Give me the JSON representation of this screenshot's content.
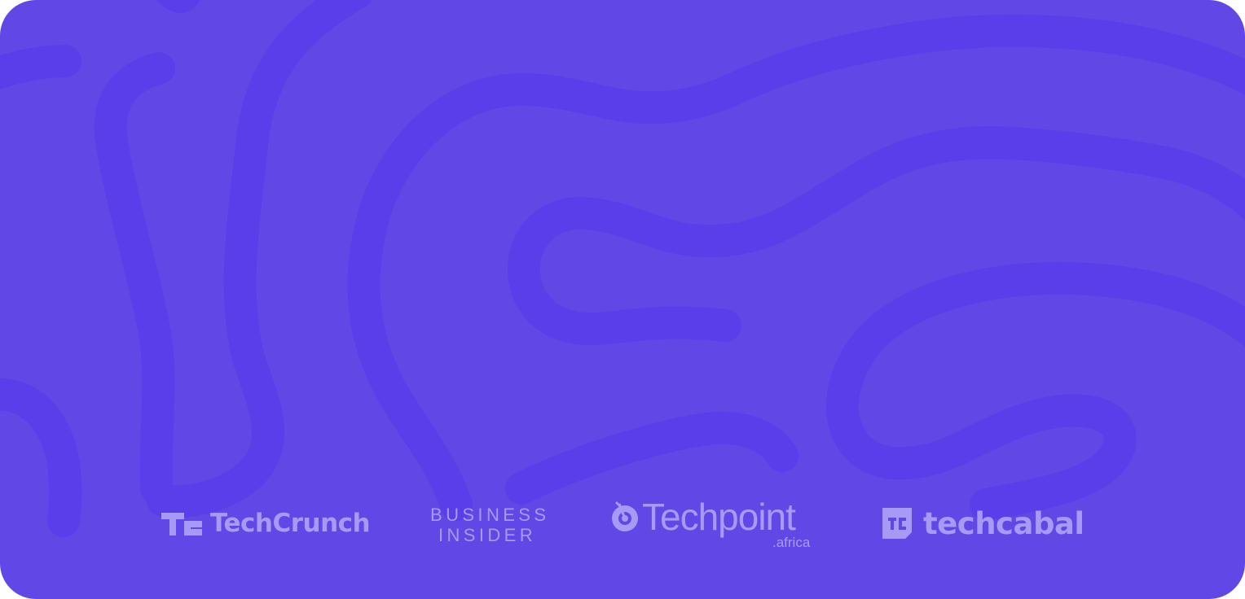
{
  "background_color": "#6148e6",
  "line_color": "#5a3ee9",
  "logo_color": "#a79af4",
  "press_logos": [
    {
      "name": "TechCrunch",
      "icon": "techcrunch-tc-icon"
    },
    {
      "name_line1": "BUSINESS",
      "name_line2": "INSIDER"
    },
    {
      "name": "Techpoint",
      "suffix": ".africa",
      "icon": "techpoint-target-icon"
    },
    {
      "name": "techcabal",
      "icon": "techcabal-tc-icon"
    }
  ]
}
